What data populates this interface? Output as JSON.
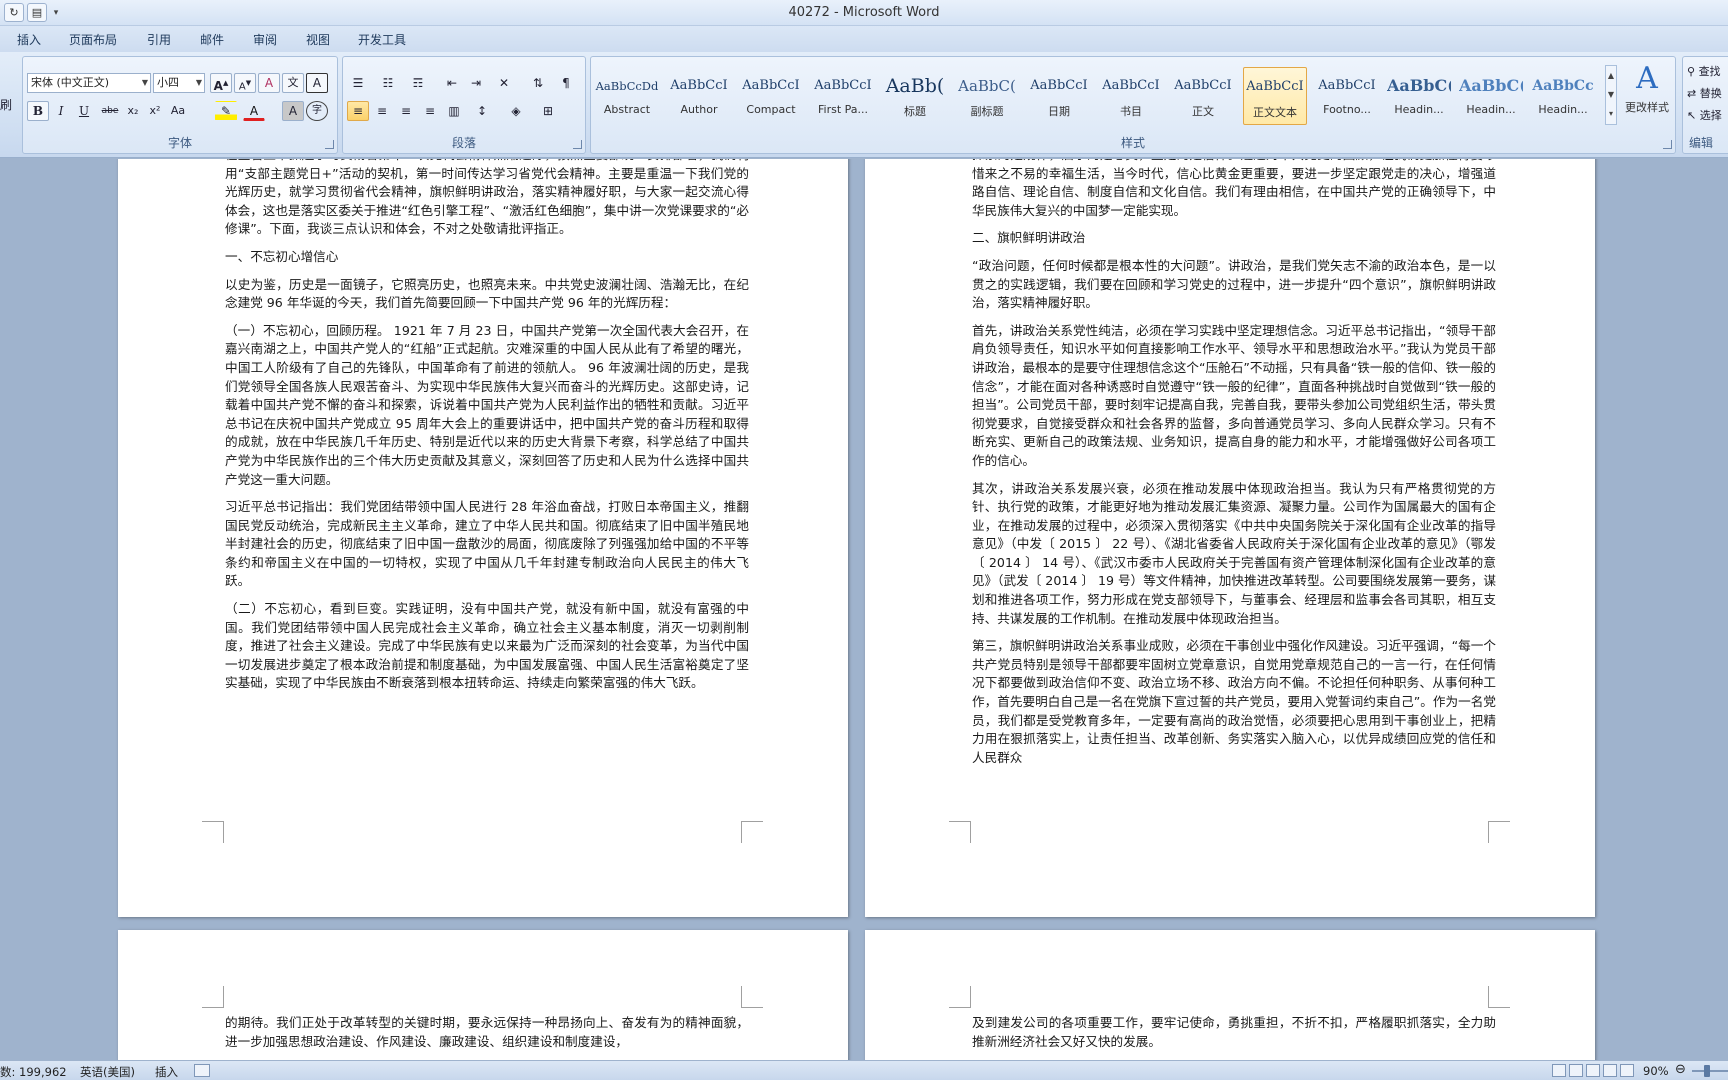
{
  "window": {
    "title": "40272 - Microsoft Word"
  },
  "tabs": [
    "插入",
    "页面布局",
    "引用",
    "邮件",
    "审阅",
    "视图",
    "开发工具"
  ],
  "ribbon": {
    "font_group": {
      "label": "字体",
      "font_name": "宋体 (中文正文)",
      "font_size": "小四",
      "bold": "B",
      "italic": "I",
      "underline": "U",
      "strike": "abe",
      "subscript": "x₂",
      "superscript": "x²",
      "change_case": "Aa",
      "grow": "A",
      "shrink": "A",
      "clear": "A",
      "char_border": "A",
      "color_a": "A",
      "shade_a": "A",
      "enclose": "字",
      "phonetic": "文"
    },
    "paragraph_group": {
      "label": "段落"
    },
    "styles_group": {
      "label": "样式",
      "change_styles_label": "更改样式",
      "styles": [
        {
          "sample": "AaBbCcDd",
          "name": "Abstract"
        },
        {
          "sample": "AaBbCcI",
          "name": "Author"
        },
        {
          "sample": "AaBbCcI",
          "name": "Compact"
        },
        {
          "sample": "AaBbCcI",
          "name": "First Pa..."
        },
        {
          "sample": "AaBb(",
          "name": "标题"
        },
        {
          "sample": "AaBbC(",
          "name": "副标题"
        },
        {
          "sample": "AaBbCcI",
          "name": "日期"
        },
        {
          "sample": "AaBbCcI",
          "name": "书目"
        },
        {
          "sample": "AaBbCcI",
          "name": "正文"
        },
        {
          "sample": "AaBbCcI",
          "name": "正文文本"
        },
        {
          "sample": "AaBbCcI",
          "name": "Footno..."
        },
        {
          "sample": "AaBbC(",
          "name": "Headin..."
        },
        {
          "sample": "AaBbC(",
          "name": "Headin..."
        },
        {
          "sample": "AaBbCc",
          "name": "Headin..."
        }
      ]
    },
    "editing_group": {
      "label": "编辑",
      "find": "查找",
      "replace": "替换",
      "select": "选择"
    },
    "left_cut": "刷"
  },
  "pages": {
    "page1": [
      "在主管上下抓起学习贯彻省第十一次党代会精神热潮之际，按照区委部统一安排部署，我们利用“支部主题党日+”活动的契机，第一时间传达学习省党代会精神。主要是重温一下我们党的光辉历史，就学习贯彻省代会精神，旗帜鲜明讲政治，落实精神履好职，与大家一起交流心得体会，这也是落实区委关于推进“红色引擎工程”、“激活红色细胞”，集中讲一次党课要求的“必修课”。下面，我谈三点认识和体会，不对之处敬请批评指正。",
      "一、不忘初心增信心",
      "以史为鉴，历史是一面镜子，它照亮历史，也照亮未来。中共党史波澜壮阔、浩瀚无比，在纪念建党 96 年华诞的今天，我们首先简要回顾一下中国共产党 96 年的光辉历程：",
      "（一）不忘初心，回顾历程。 1921 年 7 月 23 日，中国共产党第一次全国代表大会召开，在嘉兴南湖之上，中国共产党人的“红船”正式起航。灾难深重的中国人民从此有了希望的曙光，中国工人阶级有了自己的先锋队，中国革命有了前进的领航人。 96 年波澜壮阔的历史，是我们党领导全国各族人民艰苦奋斗、为实现中华民族伟大复兴而奋斗的光辉历史。这部史诗，记载着中国共产党不懈的奋斗和探索，诉说着中国共产党为人民利益作出的牺牲和贡献。习近平总书记在庆祝中国共产党成立 95 周年大会上的重要讲话中，把中国共产党的奋斗历程和取得的成就，放在中华民族几千年历史、特别是近代以来的历史大背景下考察，科学总结了中国共产党为中华民族作出的三个伟大历史贡献及其意义，深刻回答了历史和人民为什么选择中国共产党这一重大问题。",
      "习近平总书记指出：我们党团结带领中国人民进行 28 年浴血奋战，打败日本帝国主义，推翻国民党反动统治，完成新民主主义革命，建立了中华人民共和国。彻底结束了旧中国半殖民地半封建社会的历史，彻底结束了旧中国一盘散沙的局面，彻底废除了列强强加给中国的不平等条约和帝国主义在中国的一切特权，实现了中国从几千年封建专制政治向人民民主的伟大飞跃。",
      "（二）不忘初心，看到巨变。实践证明，没有中国共产党，就没有新中国，就没有富强的中国。我们党团结带领中国人民完成社会主义革命，确立社会主义基本制度，消灭一切剥削制度，推进了社会主义建设。完成了中华民族有史以来最为广泛而深刻的社会变革，为当代中国一切发展进步奠定了根本政治前提和制度基础，为中国发展富强、中国人民生活富裕奠定了坚实基础，实现了中华民族由不断衰落到根本扭转命运、持续走向繁荣富强的伟大飞跃。"
    ],
    "page2": [
      "探索的是规律，启示的是心灵，坚定的是信仰。通过对中共党史的回顾，让我们更加懂得要珍惜来之不易的幸福生活，当今时代，信心比黄金更重要，要进一步坚定跟党走的决心，增强道路自信、理论自信、制度自信和文化自信。我们有理由相信，在中国共产党的正确领导下，中华民族伟大复兴的中国梦一定能实现。",
      "二、旗帜鲜明讲政治",
      "“政治问题，任何时候都是根本性的大问题”。讲政治，是我们党矢志不渝的政治本色，是一以贯之的实践逻辑，我们要在回顾和学习党史的过程中，进一步提升“四个意识”，旗帜鲜明讲政治，落实精神履好职。",
      "首先，讲政治关系党性纯洁，必须在学习实践中坚定理想信念。习近平总书记指出，“领导干部肩负领导责任，知识水平如何直接影响工作水平、领导水平和思想政治水平。”我认为党员干部讲政治，最根本的是要守住理想信念这个“压舱石”不动摇，只有具备“铁一般的信仰、铁一般的信念”，才能在面对各种诱惑时自觉遵守“铁一般的纪律”，直面各种挑战时自觉做到“铁一般的担当”。公司党员干部，要时刻牢记提高自我，完善自我，要带头参加公司党组织生活，带头贯彻党要求，自觉接受群众和社会各界的监督，多向普通党员学习、多向人民群众学习。只有不断充实、更新自己的政策法规、业务知识，提高自身的能力和水平，才能增强做好公司各项工作的信心。",
      "其次，讲政治关系发展兴衰，必须在推动发展中体现政治担当。我认为只有严格贯彻党的方针、执行党的政策，才能更好地为推动发展汇集资源、凝聚力量。公司作为国属最大的国有企业，在推动发展的过程中，必须深入贯彻落实《中共中央国务院关于深化国有企业改革的指导意见》（中发〔 2015 〕 22 号）、《湖北省委省人民政府关于深化国有企业改革的意见》（鄂发〔 2014 〕 14 号）、《武汉市委市人民政府关于完善国有资产管理体制深化国有企业改革的意见》（武发〔 2014 〕 19 号）等文件精神，加快推进改革转型。公司要围绕发展第一要务，谋划和推进各项工作，努力形成在党支部领导下，与董事会、经理层和监事会各司其职，相互支持、共谋发展的工作机制。在推动发展中体现政治担当。",
      "第三，旗帜鲜明讲政治关系事业成败，必须在干事创业中强化作风建设。习近平强调，“每一个共产党员特别是领导干部都要牢固树立党章意识，自觉用党章规范自己的一言一行，在任何情况下都要做到政治信仰不变、政治立场不移、政治方向不偏。不论担任何种职务、从事何种工作，首先要明白自己是一名在党旗下宣过誓的共产党员，要用入党誓词约束自己”。作为一名党员，我们都是受党教育多年，一定要有高尚的政治觉悟，必须要把心思用到干事创业上，把精力用在狠抓落实上，让责任担当、改革创新、务实落实入脑入心，以优异成绩回应党的信任和人民群众"
    ],
    "page3": [
      "的期待。我们正处于改革转型的关键时期，要永远保持一种昂扬向上、奋发有为的精神面貌，进一步加强思想政治建设、作风建设、廉政建设、组织建设和制度建设，"
    ],
    "page4": [
      "及到建发公司的各项重要工作，要牢记使命，勇挑重担，不折不扣，严格履职抓落实，全力助推新洲经济社会又好又快的发展。"
    ]
  },
  "status": {
    "word_count": "数: 199,962",
    "language": "英语(美国)",
    "insert_mode": "插入",
    "zoom": "90%"
  }
}
